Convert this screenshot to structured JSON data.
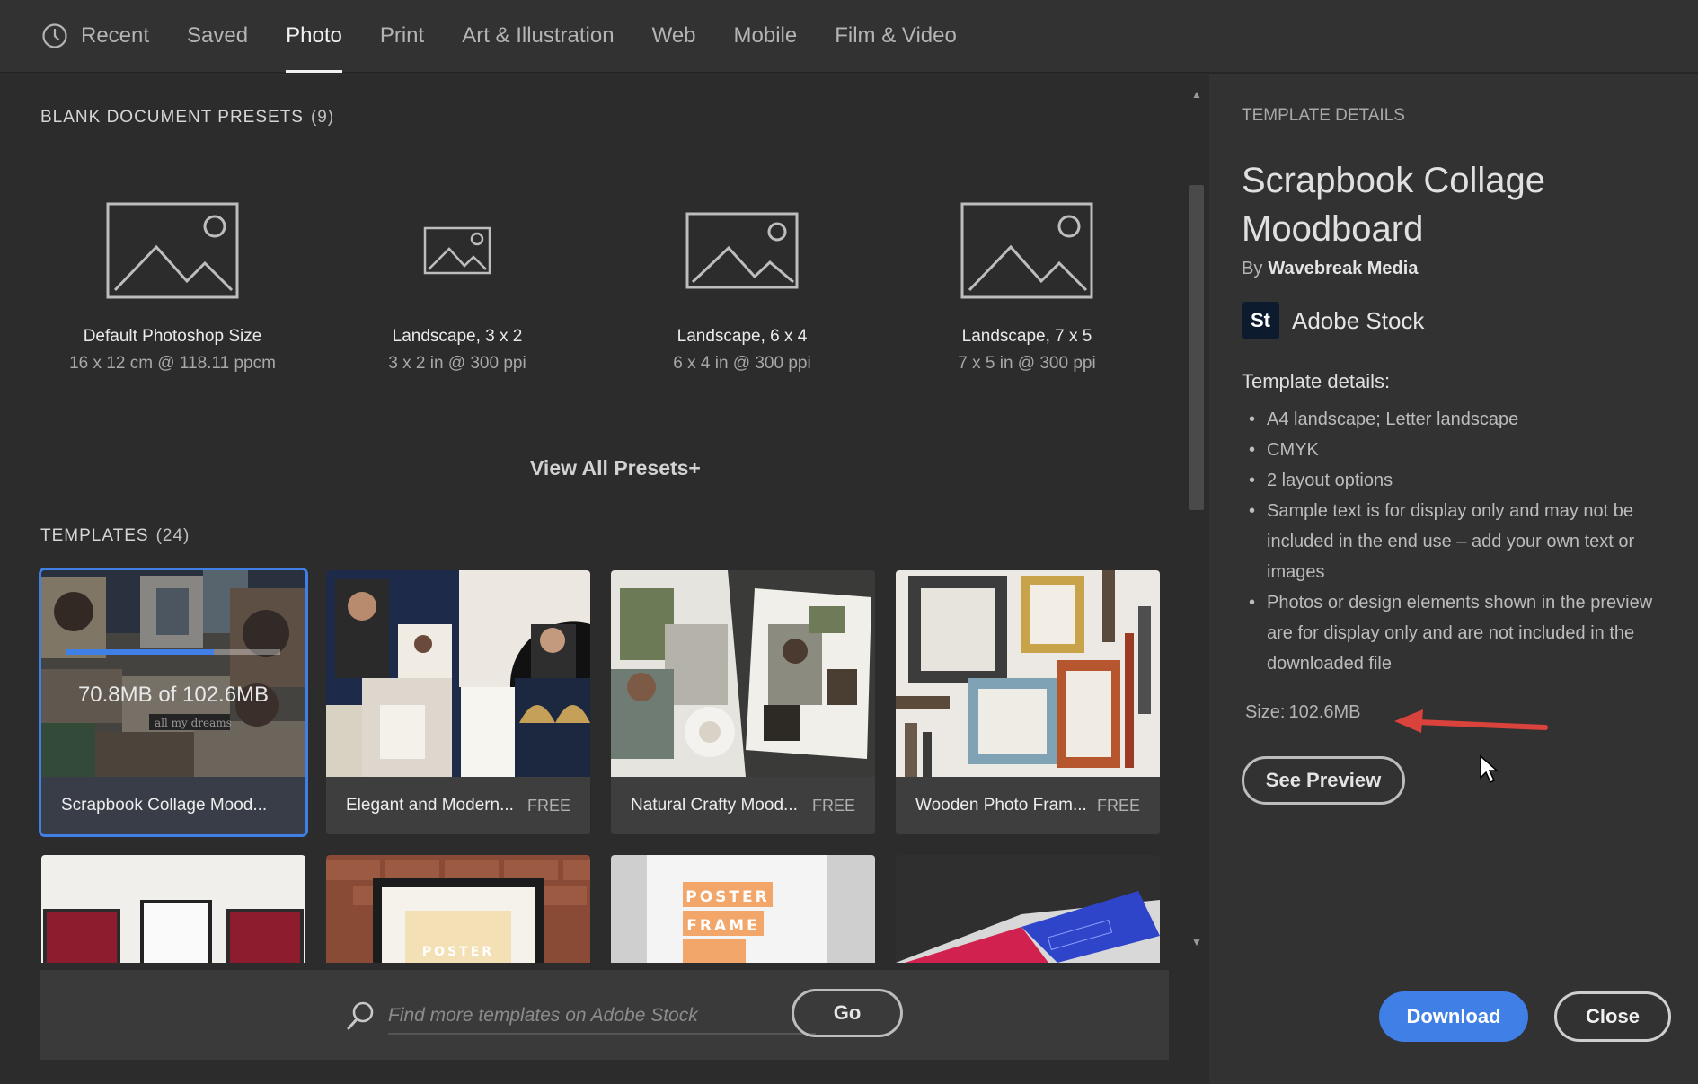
{
  "nav": {
    "tabs": [
      {
        "label": "Recent"
      },
      {
        "label": "Saved"
      },
      {
        "label": "Photo"
      },
      {
        "label": "Print"
      },
      {
        "label": "Art & Illustration"
      },
      {
        "label": "Web"
      },
      {
        "label": "Mobile"
      },
      {
        "label": "Film & Video"
      }
    ],
    "active_tab": "Photo",
    "recent_icon": "clock-icon"
  },
  "presets": {
    "title": "BLANK DOCUMENT PRESETS",
    "count": "(9)",
    "items": [
      {
        "name": "Default Photoshop Size",
        "dims": "16 x 12 cm @ 118.11 ppcm",
        "icon": "image-placeholder-icon"
      },
      {
        "name": "Landscape, 3 x 2",
        "dims": "3 x 2 in @ 300 ppi",
        "icon": "image-placeholder-icon"
      },
      {
        "name": "Landscape, 6 x 4",
        "dims": "6 x 4 in @ 300 ppi",
        "icon": "image-placeholder-icon"
      },
      {
        "name": "Landscape, 7 x 5",
        "dims": "7 x 5 in @ 300 ppi",
        "icon": "image-placeholder-icon"
      }
    ],
    "view_all": "View All Presets+"
  },
  "templates": {
    "title": "TEMPLATES",
    "count": "(24)",
    "items": [
      {
        "name": "Scrapbook Collage Mood...",
        "badge": "",
        "selected": true,
        "download_progress_text": "70.8MB of 102.6MB",
        "download_progress": 0.69
      },
      {
        "name": "Elegant and Modern...",
        "badge": "FREE"
      },
      {
        "name": "Natural Crafty Mood...",
        "badge": "FREE"
      },
      {
        "name": "Wooden Photo Fram...",
        "badge": "FREE"
      }
    ],
    "row2_texts": {
      "poster_label": "POSTER",
      "poster_frame_line1": "POSTER",
      "poster_frame_line2": "FRAME"
    }
  },
  "search": {
    "placeholder": "Find more templates on Adobe Stock",
    "go_label": "Go",
    "icon": "search-icon"
  },
  "details": {
    "section_label": "TEMPLATE DETAILS",
    "title": "Scrapbook Collage Moodboard",
    "by_label": "By",
    "author": "Wavebreak Media",
    "stock_badge": "St",
    "stock_name": "Adobe Stock",
    "details_heading": "Template details:",
    "bullets": [
      "A4 landscape; Letter landscape",
      "CMYK",
      "2 layout options",
      "Sample text is for display only and may not be included in the end use – add your own text or images",
      "Photos or design elements shown in the preview are for display only and are not included in the downloaded file"
    ],
    "size_label": "Size:",
    "size_value": "102.6MB",
    "preview_label": "See Preview",
    "download_label": "Download",
    "close_label": "Close"
  },
  "colors": {
    "accent": "#3f7fe6",
    "annotation_arrow": "#d9433b",
    "background": "#2c2c2c",
    "panel": "#323232"
  }
}
